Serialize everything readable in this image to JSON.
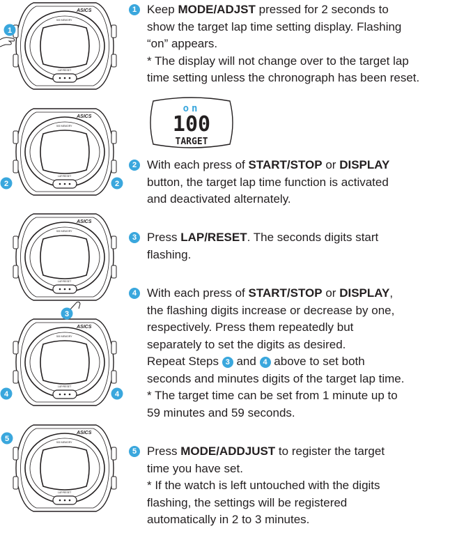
{
  "colors": {
    "accent": "#3aa7dd",
    "ink": "#231f20"
  },
  "watch_labels": {
    "brand": "ASICS",
    "top_small": "500 MEMORY",
    "bottom_small": "LAP/RESET",
    "marker_1": "1",
    "marker_2_left": "2",
    "marker_2_right": "2",
    "marker_3": "3",
    "marker_4_left": "4",
    "marker_4_right": "4",
    "marker_5": "5"
  },
  "display": {
    "top": "on",
    "digits": "100",
    "label": "TARGET"
  },
  "steps": [
    {
      "number": "1",
      "lines": [
        [
          {
            "t": "Keep "
          },
          {
            "b": "MODE/ADJST"
          },
          {
            "t": " pressed for 2 seconds to"
          }
        ],
        [
          {
            "t": "show the target lap time setting display.  Flashing"
          }
        ],
        [
          {
            "t": "“on” appears."
          }
        ],
        [
          {
            "t": "* The display will not change over to the target lap"
          }
        ],
        [
          {
            "t": "time setting unless the chronograph has been reset."
          }
        ]
      ]
    },
    {
      "number": "2",
      "lines": [
        [
          {
            "t": "With each press of "
          },
          {
            "b": "START/STOP"
          },
          {
            "t": " or "
          },
          {
            "b": "DISPLAY"
          }
        ],
        [
          {
            "t": "button, the target lap time function is activated"
          }
        ],
        [
          {
            "t": "and deactivated alternately."
          }
        ]
      ]
    },
    {
      "number": "3",
      "lines": [
        [
          {
            "t": "Press "
          },
          {
            "b": "LAP/RESET"
          },
          {
            "t": ".  The seconds digits start"
          }
        ],
        [
          {
            "t": "flashing."
          }
        ]
      ]
    },
    {
      "number": "4",
      "lines": [
        [
          {
            "t": "With each press of "
          },
          {
            "b": "START/STOP"
          },
          {
            "t": " or "
          },
          {
            "b": "DISPLAY"
          },
          {
            "t": ","
          }
        ],
        [
          {
            "t": "the flashing digits increase or decrease by one,"
          }
        ],
        [
          {
            "t": "respectively.  Press them repeatedly but"
          }
        ],
        [
          {
            "t": "separately to set the digits as desired."
          }
        ],
        [
          {
            "t": "Repeat Steps "
          },
          {
            "n": "3"
          },
          {
            "t": " and "
          },
          {
            "n": "4"
          },
          {
            "t": " above to set both"
          }
        ],
        [
          {
            "t": "seconds and minutes digits of the target lap time."
          }
        ],
        [
          {
            "t": "* The target time can be set from 1 minute up to"
          }
        ],
        [
          {
            "t": "59 minutes and 59 seconds."
          }
        ]
      ]
    },
    {
      "number": "5",
      "lines": [
        [
          {
            "t": "Press "
          },
          {
            "b": "MODE/ADDJUST"
          },
          {
            "t": " to register the target"
          }
        ],
        [
          {
            "t": "time you have set."
          }
        ],
        [
          {
            "t": "* If the watch is left untouched with the digits"
          }
        ],
        [
          {
            "t": "flashing, the settings will be registered"
          }
        ],
        [
          {
            "t": "automatically in 2 to 3 minutes."
          }
        ]
      ]
    }
  ]
}
